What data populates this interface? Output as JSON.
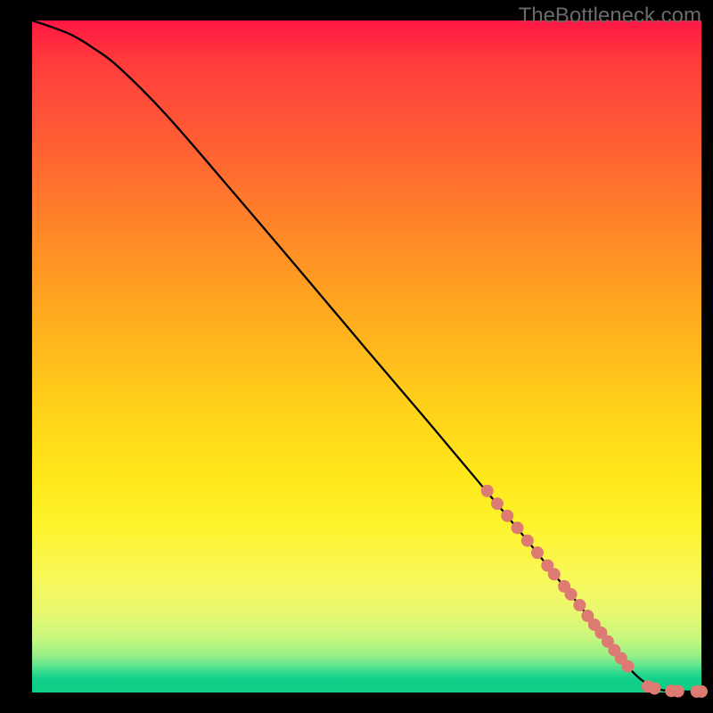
{
  "watermark": "TheBottleneck.com",
  "chart_data": {
    "type": "line",
    "title": "",
    "xlabel": "",
    "ylabel": "",
    "xlim": [
      0,
      100
    ],
    "ylim": [
      0,
      100
    ],
    "series": [
      {
        "name": "curve",
        "x": [
          0,
          3,
          6,
          9,
          13,
          20,
          30,
          40,
          50,
          60,
          68,
          74,
          78,
          82,
          86,
          88,
          90,
          92,
          94,
          96,
          98,
          100
        ],
        "y": [
          100,
          99,
          97.8,
          96,
          93,
          86,
          74.5,
          62.8,
          51,
          39.3,
          29.8,
          22.6,
          17.6,
          12.7,
          7.6,
          5.1,
          2.8,
          1.2,
          0.4,
          0.2,
          0.15,
          0.15
        ]
      }
    ],
    "markers": [
      {
        "x": 68.0,
        "y": 30.0
      },
      {
        "x": 69.5,
        "y": 28.1
      },
      {
        "x": 71.0,
        "y": 26.3
      },
      {
        "x": 72.5,
        "y": 24.5
      },
      {
        "x": 74.0,
        "y": 22.6
      },
      {
        "x": 75.5,
        "y": 20.8
      },
      {
        "x": 77.0,
        "y": 18.9
      },
      {
        "x": 78.0,
        "y": 17.6
      },
      {
        "x": 79.5,
        "y": 15.8
      },
      {
        "x": 80.5,
        "y": 14.6
      },
      {
        "x": 81.8,
        "y": 13.0
      },
      {
        "x": 83.0,
        "y": 11.4
      },
      {
        "x": 84.0,
        "y": 10.1
      },
      {
        "x": 85.0,
        "y": 8.9
      },
      {
        "x": 86.0,
        "y": 7.6
      },
      {
        "x": 87.0,
        "y": 6.3
      },
      {
        "x": 88.0,
        "y": 5.1
      },
      {
        "x": 89.0,
        "y": 3.9
      },
      {
        "x": 92.0,
        "y": 0.9
      },
      {
        "x": 93.0,
        "y": 0.6
      },
      {
        "x": 95.5,
        "y": 0.25
      },
      {
        "x": 96.5,
        "y": 0.2
      },
      {
        "x": 99.3,
        "y": 0.15
      },
      {
        "x": 100.0,
        "y": 0.15
      }
    ],
    "marker_radius_px": 7
  }
}
